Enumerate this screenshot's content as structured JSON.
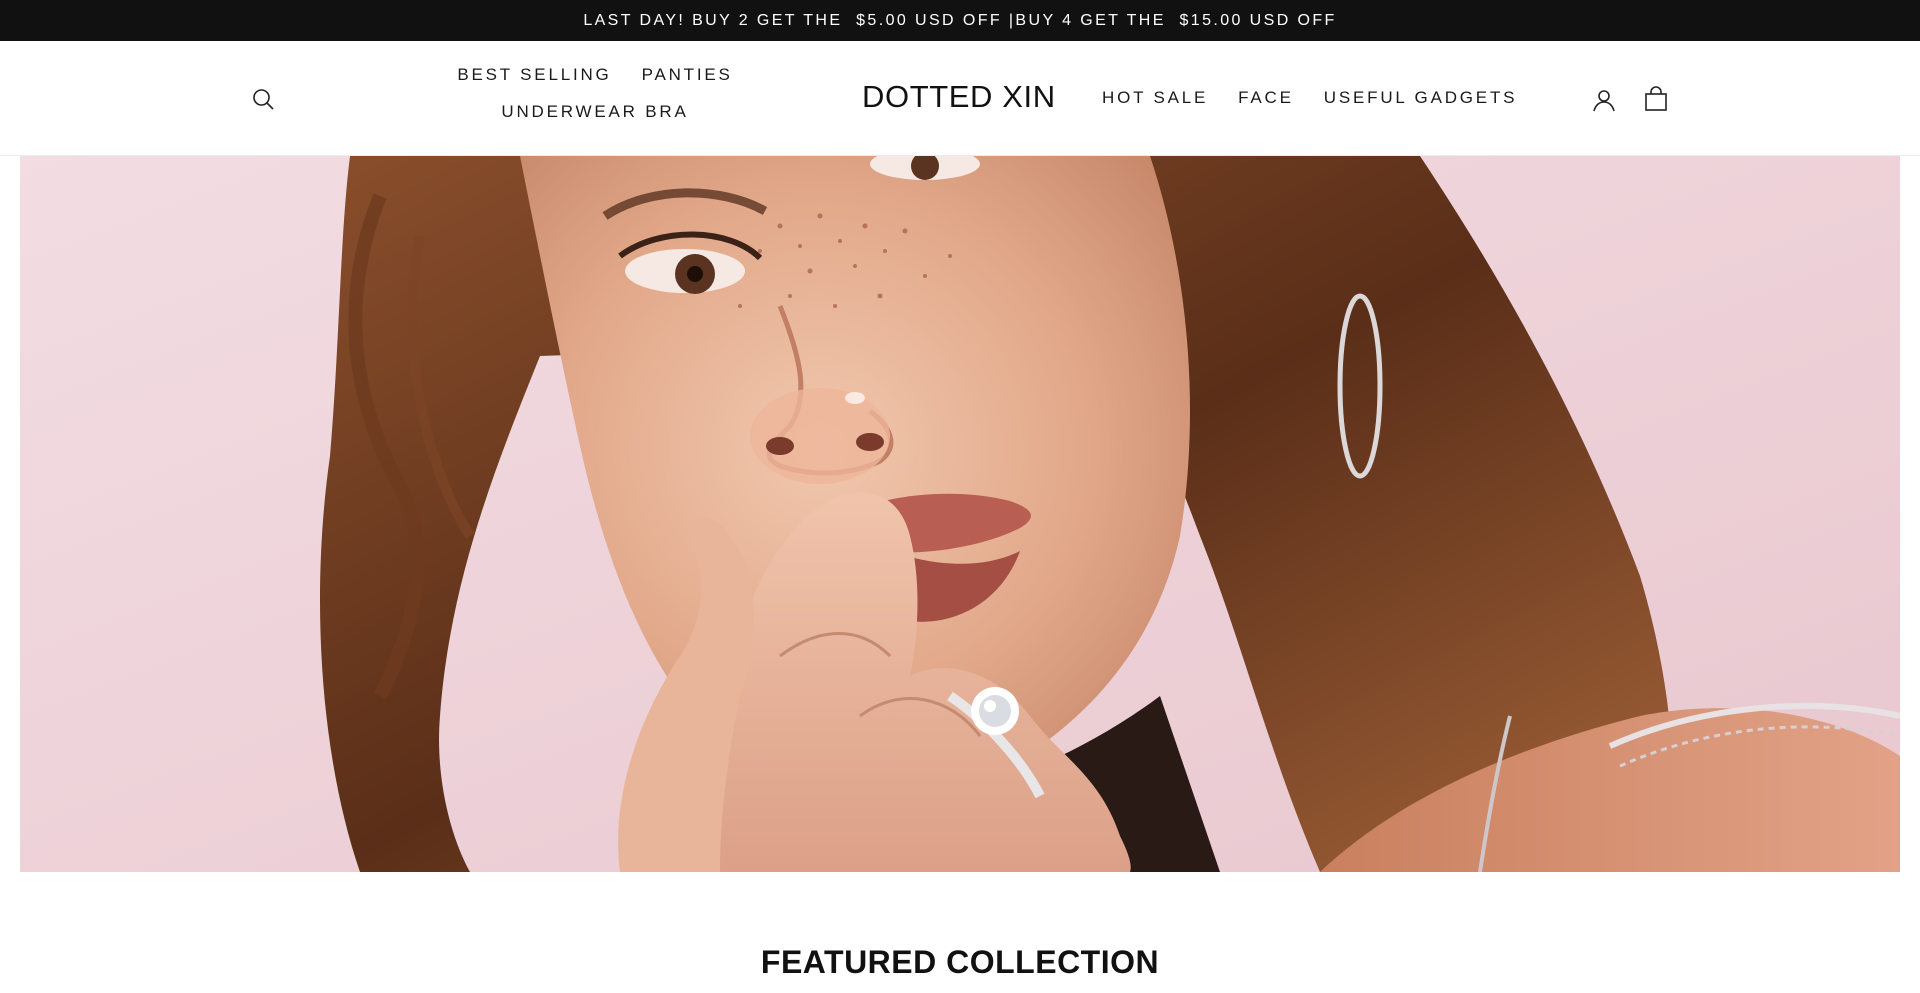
{
  "announcement": {
    "text": "LAST DAY! BUY 2 GET THE  $5.00 USD OFF |BUY 4 GET THE  $15.00 USD OFF"
  },
  "header": {
    "logo": "DOTTED XIN",
    "nav_left": [
      {
        "label": "BEST SELLING"
      },
      {
        "label": "PANTIES"
      },
      {
        "label": "UNDERWEAR BRA"
      }
    ],
    "nav_right": [
      {
        "label": "HOT SALE"
      },
      {
        "label": "FACE"
      },
      {
        "label": "USEFUL GADGETS"
      }
    ],
    "icons": {
      "search": "search-icon",
      "account": "account-icon",
      "cart": "cart-icon"
    }
  },
  "hero": {
    "image": "hero-image-model-with-ring",
    "colors": {
      "background": "#efd4da",
      "hair": "#6b3a22",
      "skin": "#e6b193",
      "lips": "#b85e52"
    }
  },
  "featured": {
    "title": "FEATURED COLLECTION"
  },
  "colors": {
    "announcement_bg": "#111111",
    "announcement_text": "#ffffff",
    "text": "#1a1a1a"
  }
}
